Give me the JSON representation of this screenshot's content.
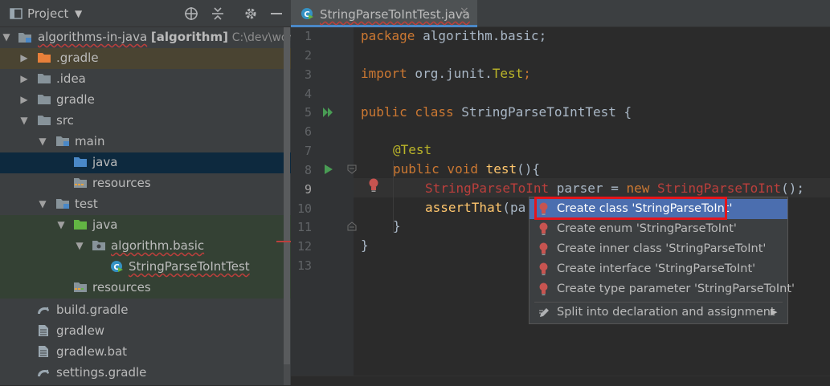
{
  "project_panel": {
    "title": "Project",
    "tree": [
      {
        "label": "algorithms-in-java",
        "module": "[algorithm]",
        "path": "C:\\dev\\works"
      },
      {
        "label": ".gradle"
      },
      {
        "label": ".idea"
      },
      {
        "label": "gradle"
      },
      {
        "label": "src"
      },
      {
        "label": "main"
      },
      {
        "label": "java"
      },
      {
        "label": "resources"
      },
      {
        "label": "test"
      },
      {
        "label": "java"
      },
      {
        "label": "algorithm.basic"
      },
      {
        "label": "StringParseToIntTest"
      },
      {
        "label": "resources"
      },
      {
        "label": "build.gradle"
      },
      {
        "label": "gradlew"
      },
      {
        "label": "gradlew.bat"
      },
      {
        "label": "settings.gradle"
      }
    ]
  },
  "editor": {
    "tab_label": "StringParseToIntTest.java",
    "line_numbers": [
      "1",
      "2",
      "3",
      "4",
      "5",
      "6",
      "7",
      "8",
      "9",
      "10",
      "11",
      "12",
      "13"
    ],
    "code": {
      "l1_kw": "package",
      "l1_rest": " algorithm.basic;",
      "l3_kw": "import",
      "l3_pkg": " org.junit.",
      "l3_cls": "Test",
      "l3_end": ";",
      "l5_kw": "public class",
      "l5_rest": " StringParseToIntTest {",
      "l7_ann": "@Test",
      "l8_kw": "public void",
      "l8_fn": " test",
      "l8_rest": "(){",
      "l9_type": "StringParseToInt",
      "l9_mid": " parser = ",
      "l9_new": "new",
      "l9_ctor": " StringParseToInt",
      "l9_end": "();",
      "l10_fn": "assertThat",
      "l10_rest": "(pa",
      "l11": "}",
      "l12": "}"
    }
  },
  "popup": {
    "items": [
      "Create class 'StringParseToInt'",
      "Create enum 'StringParseToInt'",
      "Create inner class 'StringParseToInt'",
      "Create interface 'StringParseToInt'",
      "Create type parameter 'StringParseToInt'"
    ],
    "split_item": "Split into declaration and assignment"
  },
  "colors": {
    "selection": "#4b6eaf",
    "highlight_box": "#e4151b",
    "error": "#bc3f3c",
    "keyword": "#cc7832"
  }
}
